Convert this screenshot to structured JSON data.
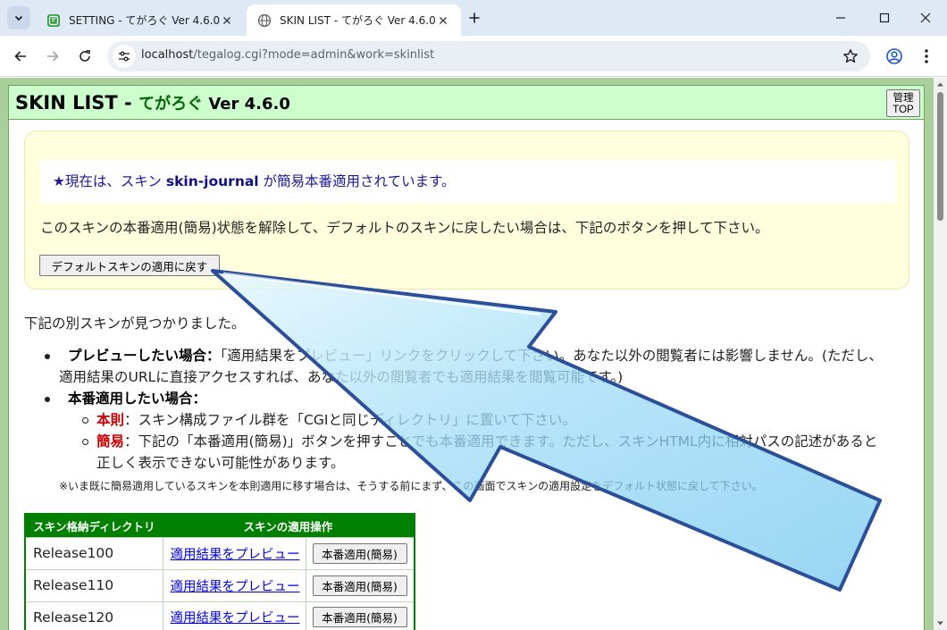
{
  "browser": {
    "tabs": [
      {
        "title": "SETTING - てがろぐ Ver 4.6.0",
        "active": false
      },
      {
        "title": "SKIN LIST - てがろぐ Ver 4.6.0",
        "active": true
      }
    ],
    "url_host": "localhost",
    "url_rest": "/tegalog.cgi?mode=admin&work=skinlist",
    "icons": {
      "tab_search": "chevron-down-icon",
      "new_tab": "plus-icon",
      "minimize": "minimize-icon",
      "maximize": "maximize-icon",
      "close": "close-icon",
      "back": "back-arrow-icon",
      "forward": "forward-arrow-icon",
      "reload": "reload-icon",
      "site_info": "tune-icon",
      "bookmark": "star-icon",
      "profile": "account-icon",
      "menu": "kebab-menu-icon"
    }
  },
  "page": {
    "title_main": "SKIN LIST - ",
    "title_app": "てがろぐ",
    "title_ver": " Ver 4.6.0",
    "admin_top_label": "管理\nTOP",
    "notice": {
      "status_prefix": "★現在は、スキン ",
      "status_skin": "skin-journal",
      "status_suffix": " が簡易本番適用されています。",
      "explanation": "このスキンの本番適用(簡易)状態を解除して、デフォルトのスキンに戻したい場合は、下記のボタンを押して下さい。",
      "default_button": "デフォルトスキンの適用に戻す"
    },
    "found_text": "下記の別スキンが見つかりました。",
    "guide": {
      "preview_head": "プレビューしたい場合：",
      "preview_text1": "「適用結果をプレビュー」リンクをクリックして下さい。あなた以外の閲覧者には影響しません。(ただし、",
      "preview_text2": "適用結果のURLに直接アクセスすれば、あなた以外の閲覧者でも適用結果を閲覧可能です。)",
      "production_head": "本番適用したい場合：",
      "rule_label": "本則",
      "rule_text": "：スキン構成ファイル群を「CGIと同じディレクトリ」に置いて下さい。",
      "simple_label": "簡易",
      "simple_text1": "：下記の「本番適用(簡易)」ボタンを押すことでも本番適用できます。ただし、スキンHTML内に相対パスの記述があると",
      "simple_text2": "正しく表示できない可能性があります。",
      "note": "※いま既に簡易適用しているスキンを本則適用に移す場合は、そうする前にまず、この画面でスキンの適用設定をデフォルト状態に戻して下さい。"
    },
    "table": {
      "headers": [
        "スキン格納ディレクトリ",
        "スキンの適用操作"
      ],
      "rows": [
        {
          "dir": "Release100",
          "preview": "適用結果をプレビュー",
          "apply": "本番適用(簡易)"
        },
        {
          "dir": "Release110",
          "preview": "適用結果をプレビュー",
          "apply": "本番適用(簡易)"
        },
        {
          "dir": "Release120",
          "preview": "適用結果をプレビュー",
          "apply": "本番適用(簡易)"
        }
      ]
    }
  },
  "colors": {
    "header_bg": "#ccffcc",
    "page_border": "#6fa35c",
    "table_green": "#008000",
    "notice_bg": "#ffffdd",
    "link": "#0000ee",
    "accent_red": "#cc0000",
    "arrow_fill": "#a8e4fb",
    "arrow_stroke": "#2c4f9a"
  }
}
